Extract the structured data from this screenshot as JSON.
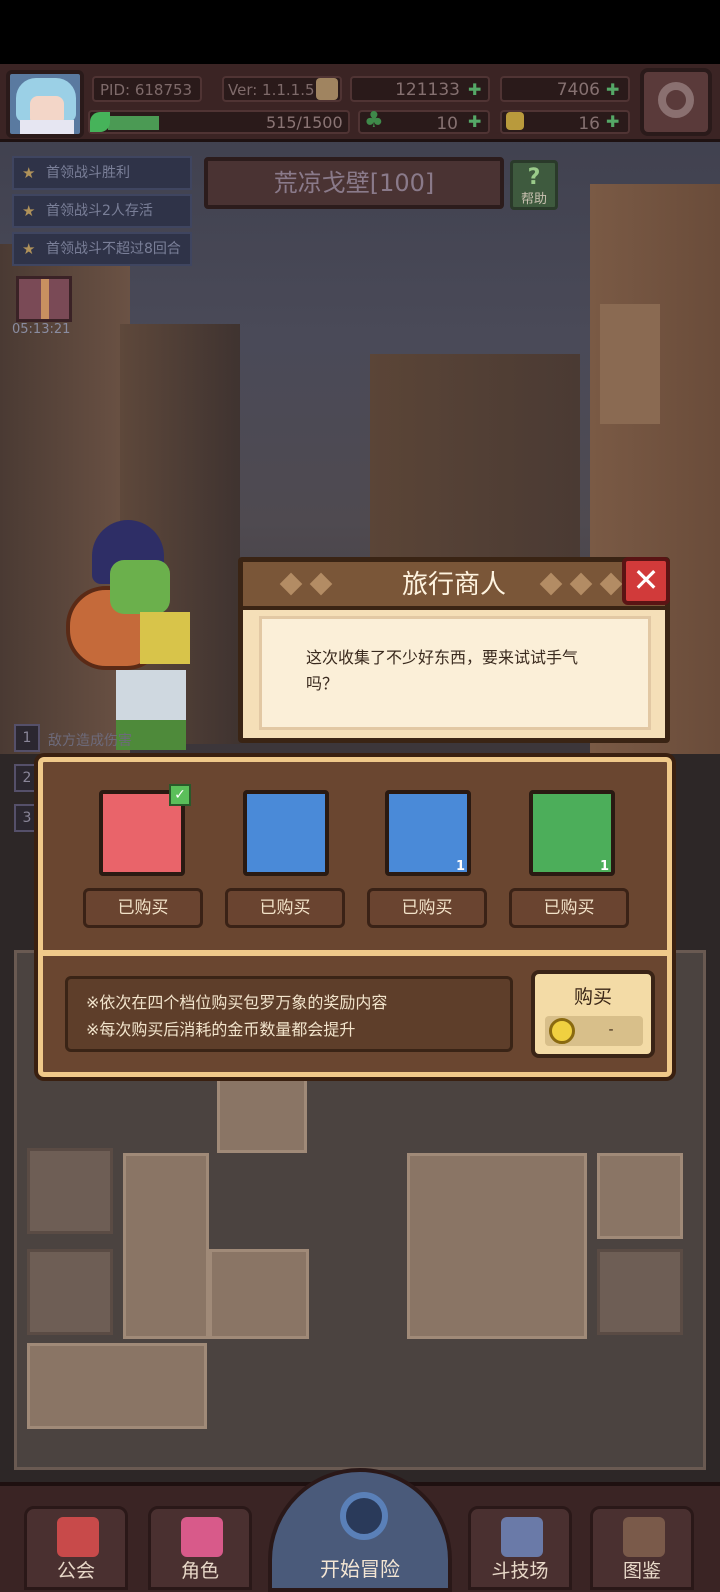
{
  "hud": {
    "pid": "PID: 618753",
    "version": "Ver: 1.1.1.5",
    "gold": "121133",
    "gems": "7406",
    "exp": "515/1500",
    "exp_progress": 0.343,
    "clover": "10",
    "keys": "16"
  },
  "quests": [
    {
      "label": "首领战斗胜利"
    },
    {
      "label": "首领战斗2人存活"
    },
    {
      "label": "首领战斗不超过8回合"
    }
  ],
  "stage": {
    "title": "荒凉戈壁[100]"
  },
  "help": {
    "label": "帮助",
    "icon": "?"
  },
  "gift": {
    "timer": "05:13:21"
  },
  "battle_lines": [
    {
      "num": "1",
      "text": "敌方造成伤害"
    },
    {
      "num": "2",
      "text": ""
    },
    {
      "num": "3",
      "text": ""
    }
  ],
  "dialog": {
    "title": "旅行商人",
    "message_line1": "这次收集了不少好东西，要来试试手气",
    "message_line2": "吗？",
    "close_icon": "✕"
  },
  "shop": {
    "slots": [
      {
        "item": "heart-necklace-icon",
        "bg": "#e9646a",
        "count": "",
        "status": "已购买"
      },
      {
        "item": "heart-card-icon",
        "bg": "#4a8ad8",
        "count": "",
        "status": "已购买"
      },
      {
        "item": "treasure-chest-icon",
        "bg": "#4a8ad8",
        "count": "1",
        "status": "已购买"
      },
      {
        "item": "spellbook-icon",
        "bg": "#4cae5a",
        "count": "1",
        "status": "已购买"
      }
    ],
    "info_line1": "※依次在四个档位购买包罗万象的奖励内容",
    "info_line2": "※每次购买后消耗的金币数量都会提升",
    "buy_label": "购买",
    "buy_cost": "-"
  },
  "nav": {
    "guild": "公会",
    "character": "角色",
    "adventure": "开始冒险",
    "arena": "斗技场",
    "codex": "图鉴"
  }
}
